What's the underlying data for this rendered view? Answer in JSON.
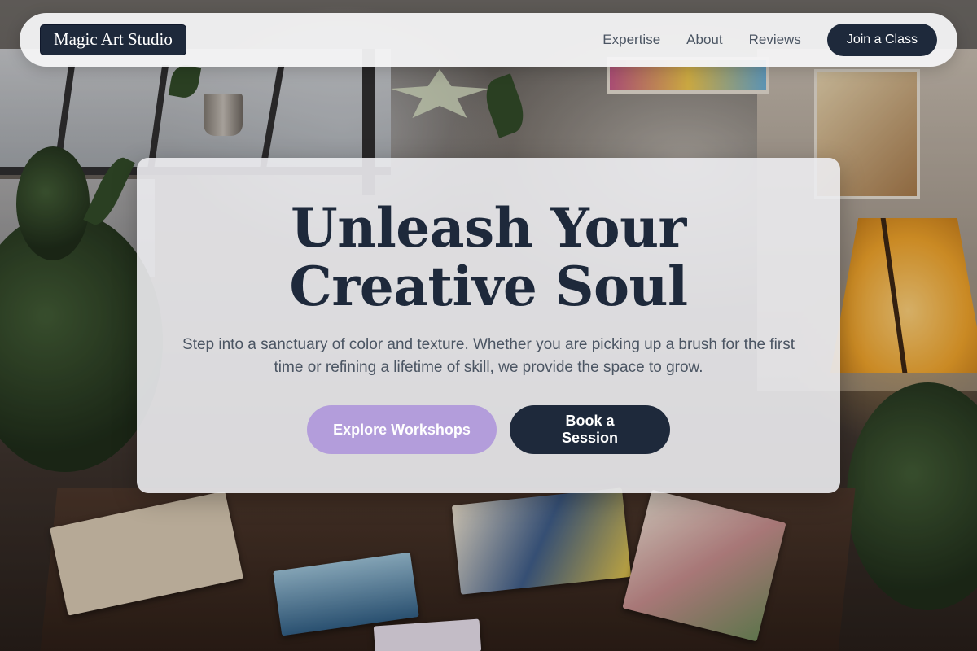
{
  "brand": {
    "name": "Magic Art Studio"
  },
  "nav": {
    "links": [
      "Expertise",
      "About",
      "Reviews"
    ],
    "cta_label": "Join a Class"
  },
  "hero": {
    "title": "Unleash Your Creative Soul",
    "subtitle": "Step into a sanctuary of color and texture. Whether you are picking up a brush for the first time or refining a lifetime of skill, we provide the space to grow.",
    "primary_label": "Explore Workshops",
    "secondary_label": "Book a Session"
  },
  "colors": {
    "navy": "#1e293b",
    "lavender": "#b39ddb",
    "muted_text": "#4b5563"
  },
  "background": {
    "icon": "art-studio-photo"
  }
}
